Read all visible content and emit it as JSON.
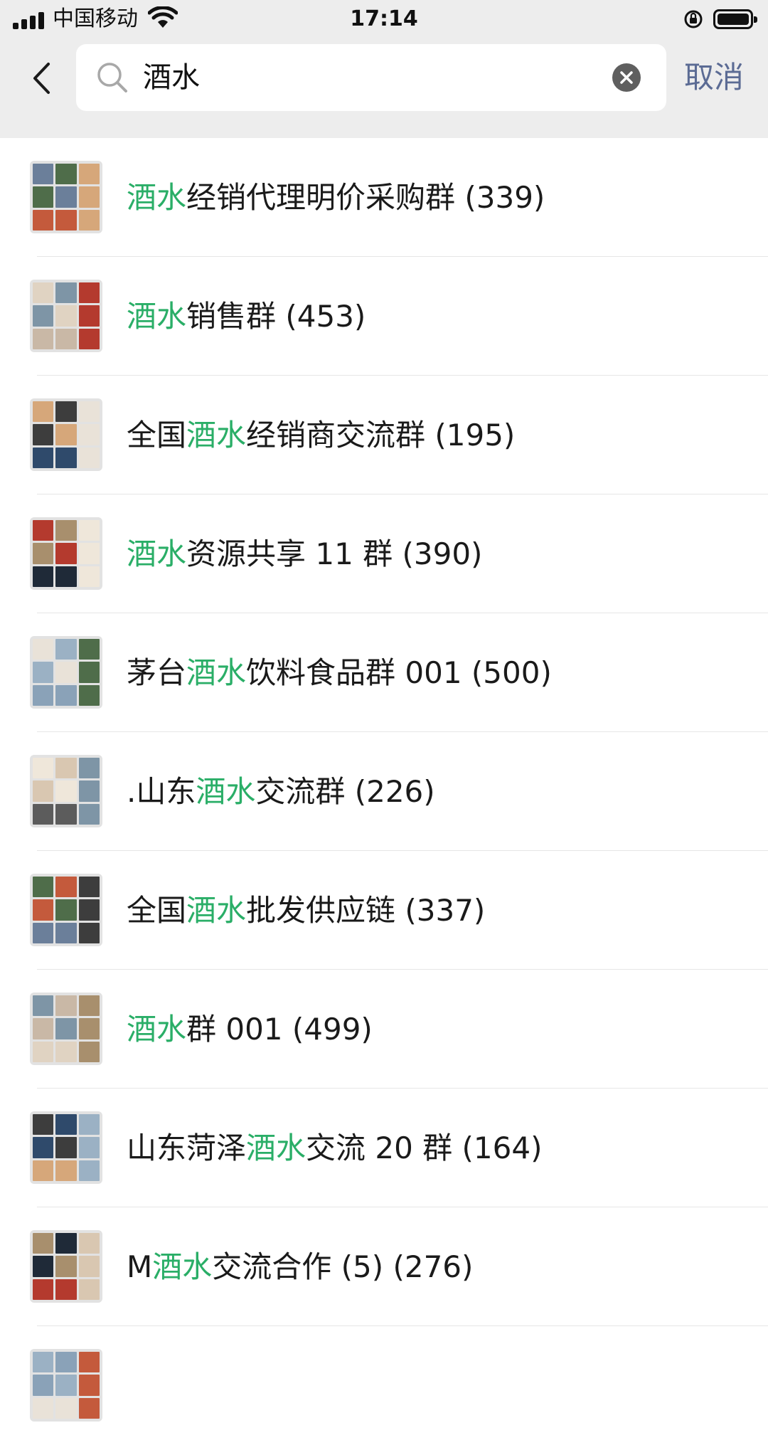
{
  "status_bar": {
    "carrier": "中国移动",
    "time": "17:14"
  },
  "search": {
    "query": "酒水",
    "cancel_label": "取消"
  },
  "colors": {
    "highlight": "#2aae67",
    "cancel": "#5b6b94",
    "header_bg": "#ededed"
  },
  "results": [
    {
      "before": "",
      "match": "酒水",
      "after": "经销代理明价采购群 (339)"
    },
    {
      "before": "",
      "match": "酒水",
      "after": "销售群 (453)"
    },
    {
      "before": "全国",
      "match": "酒水",
      "after": "经销商交流群 (195)"
    },
    {
      "before": "",
      "match": "酒水",
      "after": "资源共享 11 群 (390)"
    },
    {
      "before": "茅台",
      "match": "酒水",
      "after": "饮料食品群 001 (500)"
    },
    {
      "before": ".山东",
      "match": "酒水",
      "after": "交流群 (226)"
    },
    {
      "before": "全国",
      "match": "酒水",
      "after": "批发供应链 (337)"
    },
    {
      "before": "",
      "match": "酒水",
      "after": "群 001 (499)"
    },
    {
      "before": "山东菏泽",
      "match": "酒水",
      "after": "交流 20 群 (164)"
    },
    {
      "before": "M",
      "match": "酒水",
      "after": "交流合作 (5) (276)"
    },
    {
      "before": "",
      "match": "",
      "after": ""
    }
  ]
}
